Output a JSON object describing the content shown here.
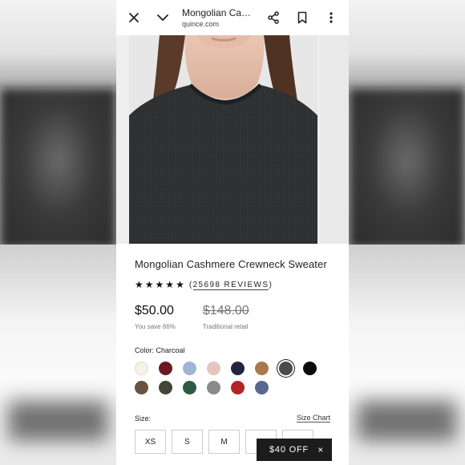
{
  "browser": {
    "page_title": "Mongolian Cash...",
    "domain": "quince.com"
  },
  "icons": [
    "close-icon",
    "chevron-down-icon",
    "share-icon",
    "bookmark-icon",
    "more-vertical-icon",
    "star-icon"
  ],
  "product": {
    "name": "Mongolian Cashmere Crewneck Sweater",
    "stars": 5,
    "reviews_open": "(",
    "reviews_count": "25698 REVIEWS",
    "reviews_close": ")",
    "price": "$50.00",
    "savings": "You save 66%",
    "traditional_price": "$148.00",
    "traditional_label": "Traditional retail"
  },
  "color": {
    "label": "Color: Charcoal",
    "selected_index": 6,
    "swatches": [
      {
        "name": "Ivory",
        "hex": "#f7f3e3"
      },
      {
        "name": "Burgundy",
        "hex": "#6b1a22"
      },
      {
        "name": "Light Blue",
        "hex": "#9fb5d4"
      },
      {
        "name": "Blush",
        "hex": "#e3c6bf"
      },
      {
        "name": "Navy",
        "hex": "#1f2540"
      },
      {
        "name": "Camel",
        "hex": "#a9784d"
      },
      {
        "name": "Charcoal",
        "hex": "#4a4b4f"
      },
      {
        "name": "Black",
        "hex": "#0b0b0b"
      },
      {
        "name": "Brown",
        "hex": "#6a5340"
      },
      {
        "name": "Olive",
        "hex": "#414636"
      },
      {
        "name": "Forest Green",
        "hex": "#2e5b45"
      },
      {
        "name": "Grey",
        "hex": "#8a8a8a"
      },
      {
        "name": "Red",
        "hex": "#b4232a"
      },
      {
        "name": "Slate Blue",
        "hex": "#5a6790"
      }
    ]
  },
  "size": {
    "label": "Size:",
    "chart_link": "Size Chart",
    "options": [
      "XS",
      "S",
      "M",
      "",
      ""
    ]
  },
  "promo": {
    "label": "$40 OFF",
    "close": "×"
  }
}
